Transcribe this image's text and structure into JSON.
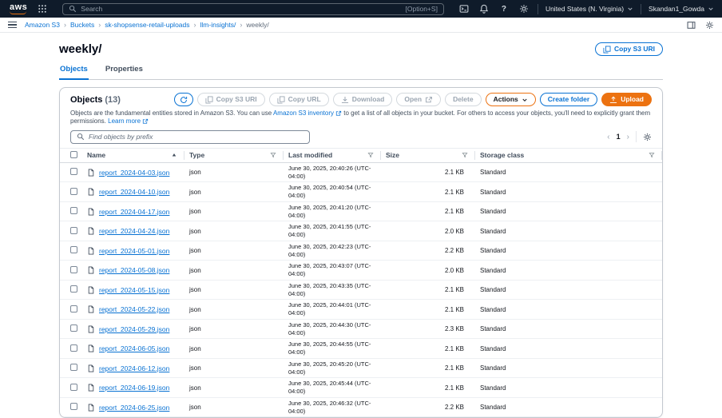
{
  "colors": {
    "header_bg": "#0f1b2a",
    "link_blue": "#0972d3",
    "accent_orange": "#ec7211"
  },
  "icons": {
    "breadcrumb_separator": "›"
  },
  "topbar": {
    "logo": "aws",
    "search_placeholder": "Search",
    "search_shortcut": "[Option+S]",
    "region": "United States (N. Virginia)",
    "user": "Skandan1_Gowda"
  },
  "breadcrumbs": [
    {
      "label": "Amazon S3"
    },
    {
      "label": "Buckets"
    },
    {
      "label": "sk-shopsense-retail-uploads"
    },
    {
      "label": "llm-insights/"
    },
    {
      "label": "weekly/"
    }
  ],
  "page": {
    "title": "weekly/",
    "copy_s3_uri": "Copy S3 URI"
  },
  "tabs": {
    "objects": "Objects",
    "properties": "Properties"
  },
  "objects": {
    "title": "Objects",
    "count": "(13)",
    "desc_pre": "Objects are the fundamental entities stored in Amazon S3. You can use ",
    "inventory_link": "Amazon S3 inventory",
    "desc_mid": " to get a list of all objects in your bucket. For others to access your objects, you'll need to explicitly grant them permissions. ",
    "learn_more": "Learn more",
    "toolbar": {
      "copy_s3_uri": "Copy S3 URI",
      "copy_url": "Copy URL",
      "download": "Download",
      "open": "Open",
      "delete": "Delete",
      "actions": "Actions",
      "create_folder": "Create folder",
      "upload": "Upload"
    },
    "find_placeholder": "Find objects by prefix",
    "pagination": {
      "prev": "‹",
      "current": "1",
      "next": "›"
    },
    "columns": {
      "name": "Name",
      "type": "Type",
      "last_modified": "Last modified",
      "size": "Size",
      "storage_class": "Storage class"
    },
    "rows": [
      {
        "name": "report_2024-04-03.json",
        "type": "json",
        "modified": "June 30, 2025, 20:40:26 (UTC-04:00)",
        "size": "2.1 KB",
        "storage_class": "Standard"
      },
      {
        "name": "report_2024-04-10.json",
        "type": "json",
        "modified": "June 30, 2025, 20:40:54 (UTC-04:00)",
        "size": "2.1 KB",
        "storage_class": "Standard"
      },
      {
        "name": "report_2024-04-17.json",
        "type": "json",
        "modified": "June 30, 2025, 20:41:20 (UTC-04:00)",
        "size": "2.1 KB",
        "storage_class": "Standard"
      },
      {
        "name": "report_2024-04-24.json",
        "type": "json",
        "modified": "June 30, 2025, 20:41:55 (UTC-04:00)",
        "size": "2.0 KB",
        "storage_class": "Standard"
      },
      {
        "name": "report_2024-05-01.json",
        "type": "json",
        "modified": "June 30, 2025, 20:42:23 (UTC-04:00)",
        "size": "2.2 KB",
        "storage_class": "Standard"
      },
      {
        "name": "report_2024-05-08.json",
        "type": "json",
        "modified": "June 30, 2025, 20:43:07 (UTC-04:00)",
        "size": "2.0 KB",
        "storage_class": "Standard"
      },
      {
        "name": "report_2024-05-15.json",
        "type": "json",
        "modified": "June 30, 2025, 20:43:35 (UTC-04:00)",
        "size": "2.1 KB",
        "storage_class": "Standard"
      },
      {
        "name": "report_2024-05-22.json",
        "type": "json",
        "modified": "June 30, 2025, 20:44:01 (UTC-04:00)",
        "size": "2.1 KB",
        "storage_class": "Standard"
      },
      {
        "name": "report_2024-05-29.json",
        "type": "json",
        "modified": "June 30, 2025, 20:44:30 (UTC-04:00)",
        "size": "2.3 KB",
        "storage_class": "Standard"
      },
      {
        "name": "report_2024-06-05.json",
        "type": "json",
        "modified": "June 30, 2025, 20:44:55 (UTC-04:00)",
        "size": "2.1 KB",
        "storage_class": "Standard"
      },
      {
        "name": "report_2024-06-12.json",
        "type": "json",
        "modified": "June 30, 2025, 20:45:20 (UTC-04:00)",
        "size": "2.1 KB",
        "storage_class": "Standard"
      },
      {
        "name": "report_2024-06-19.json",
        "type": "json",
        "modified": "June 30, 2025, 20:45:44 (UTC-04:00)",
        "size": "2.1 KB",
        "storage_class": "Standard"
      },
      {
        "name": "report_2024-06-25.json",
        "type": "json",
        "modified": "June 30, 2025, 20:46:32 (UTC-04:00)",
        "size": "2.2 KB",
        "storage_class": "Standard"
      }
    ]
  }
}
